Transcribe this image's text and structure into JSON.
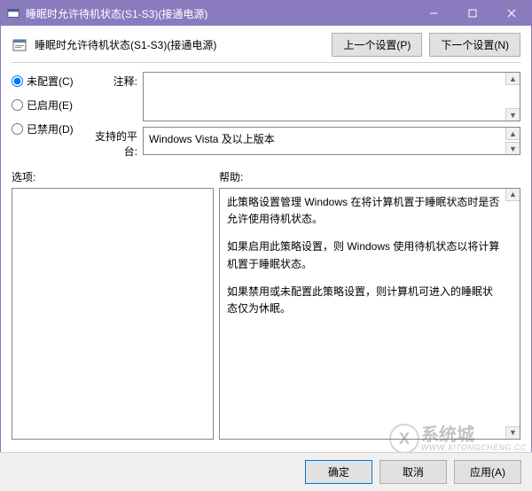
{
  "window": {
    "title": "睡眠时允许待机状态(S1-S3)(接通电源)"
  },
  "header": {
    "title": "睡眠时允许待机状态(S1-S3)(接通电源)",
    "prev_btn": "上一个设置(P)",
    "next_btn": "下一个设置(N)"
  },
  "radios": {
    "not_configured": "未配置(C)",
    "enabled": "已启用(E)",
    "disabled": "已禁用(D)"
  },
  "labels": {
    "comment": "注释:",
    "supported": "支持的平台:",
    "options": "选项:",
    "help": "帮助:"
  },
  "supported_platform": "Windows Vista 及以上版本",
  "help_text": {
    "p1": "此策略设置管理 Windows 在将计算机置于睡眠状态时是否允许使用待机状态。",
    "p2": "如果启用此策略设置，则 Windows 使用待机状态以将计算机置于睡眠状态。",
    "p3": "如果禁用或未配置此策略设置，则计算机可进入的睡眠状态仅为休眠。"
  },
  "footer": {
    "ok": "确定",
    "cancel": "取消",
    "apply": "应用(A)"
  },
  "watermark": {
    "brand": "系统城",
    "url": "WWW.XITONGCHENG.CC"
  }
}
